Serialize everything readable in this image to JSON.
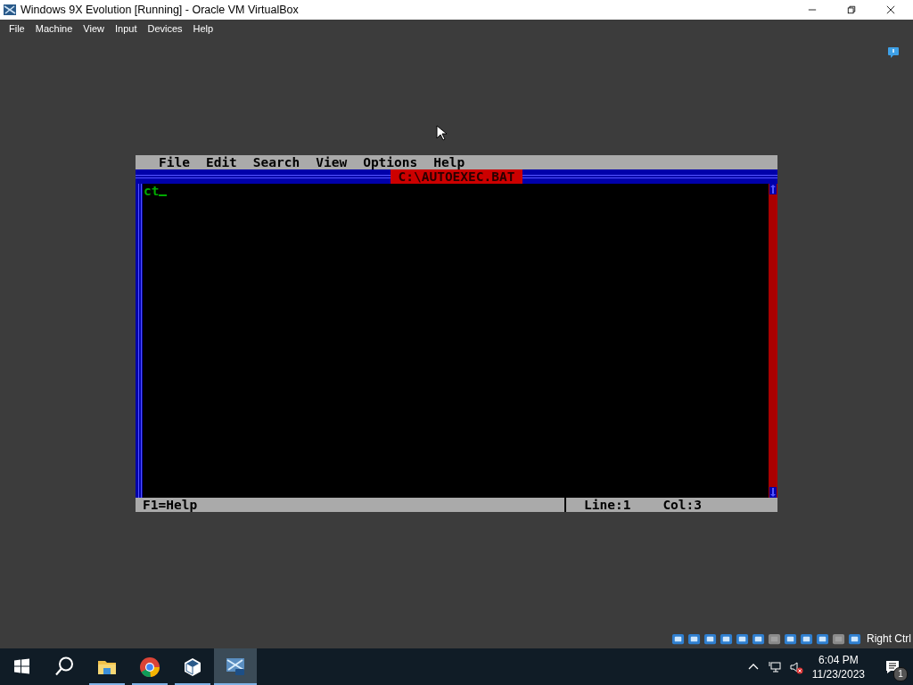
{
  "window": {
    "title": "Windows 9X Evolution [Running] - Oracle VM VirtualBox"
  },
  "menu": [
    "File",
    "Machine",
    "View",
    "Input",
    "Devices",
    "Help"
  ],
  "editor": {
    "menu": [
      "File",
      "Edit",
      "Search",
      "View",
      "Options",
      "Help"
    ],
    "document_title": "C:\\AUTOEXEC.BAT",
    "lines": [
      "ct"
    ],
    "status": {
      "hint": "F1=Help",
      "line": "Line:1",
      "column": "Col:3"
    }
  },
  "host_key": "Right Ctrl",
  "taskbar": {
    "apps": [
      {
        "kind": "explorer",
        "active": false
      },
      {
        "kind": "chrome",
        "active": false
      },
      {
        "kind": "virtualbox",
        "active": false
      },
      {
        "kind": "vm",
        "active": true
      }
    ],
    "time": "6:04 PM",
    "date": "11/23/2023",
    "notification_count": "1"
  }
}
